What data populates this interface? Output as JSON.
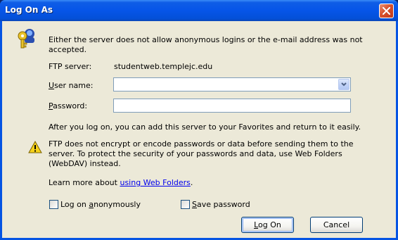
{
  "window": {
    "title": "Log On As"
  },
  "message": {
    "line1": "Either the server does not allow anonymous logins or the e-mail address was not",
    "line2": "accepted."
  },
  "server": {
    "label": "FTP server:",
    "value": "studentweb.templejc.edu"
  },
  "username": {
    "label_mnemonic": "U",
    "label_rest": "ser name:",
    "value": ""
  },
  "password": {
    "label_mnemonic": "P",
    "label_rest": "assword:",
    "value": ""
  },
  "favorites_text": "After you log on, you can add this server to your Favorites and return to it easily.",
  "warning": {
    "line1": "FTP does not encrypt or encode passwords or data before sending them to the",
    "line2": "server.  To protect the security of your passwords and data, use Web Folders",
    "line3": "(WebDAV) instead."
  },
  "learn_more": {
    "prefix": "Learn more about ",
    "link": "using Web Folders",
    "suffix": "."
  },
  "anonymous_checkbox": {
    "label_pre": "Log on ",
    "label_mnemonic": "a",
    "label_rest": "nonymously",
    "checked": false
  },
  "save_password_checkbox": {
    "label_mnemonic": "S",
    "label_rest": "ave password",
    "checked": false
  },
  "buttons": {
    "logon_mnemonic": "L",
    "logon_rest": "og On",
    "cancel": "Cancel"
  },
  "icons": {
    "dialog": "key-user-icon",
    "warning": "warning-icon",
    "close": "close-icon",
    "dropdown": "chevron-down-icon"
  },
  "colors": {
    "titlebar": "#0655e8",
    "dialog_bg": "#ece9d8",
    "close_button": "#d7512e",
    "link": "#0000ee"
  }
}
